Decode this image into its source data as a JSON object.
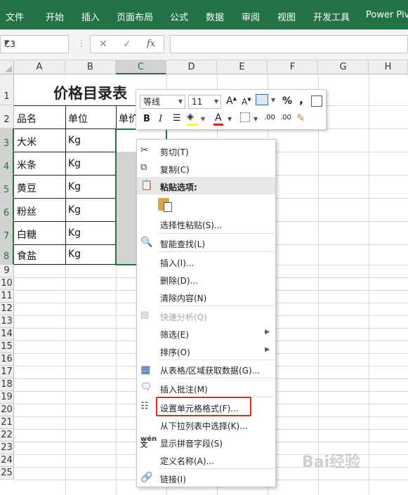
{
  "ribbon": {
    "tabs": [
      "文件",
      "开始",
      "插入",
      "页面布局",
      "公式",
      "数据",
      "审阅",
      "视图",
      "开发工具",
      "Power Pivo"
    ]
  },
  "formula_bar": {
    "name_box": "C3",
    "fx": "fx",
    "value": ""
  },
  "sheet": {
    "columns": [
      "A",
      "B",
      "C",
      "D",
      "E",
      "F",
      "G",
      "H"
    ],
    "rows": [
      "1",
      "2",
      "3",
      "4",
      "5",
      "6",
      "7",
      "8",
      "9",
      "10",
      "11",
      "12",
      "13",
      "14",
      "15",
      "16",
      "17",
      "18",
      "19",
      "20",
      "21",
      "22",
      "23",
      "24",
      "25"
    ],
    "title": "价格目录表",
    "headers": [
      "品名",
      "单位",
      "单价"
    ],
    "items": [
      {
        "name": "大米",
        "unit": "Kg"
      },
      {
        "name": "米条",
        "unit": "Kg"
      },
      {
        "name": "黄豆",
        "unit": "Kg"
      },
      {
        "name": "粉丝",
        "unit": "Kg"
      },
      {
        "name": "白糖",
        "unit": "Kg"
      },
      {
        "name": "食盐",
        "unit": "Kg"
      }
    ]
  },
  "mini_toolbar": {
    "font": "等线",
    "size": "11",
    "bold": "B",
    "italic": "I",
    "percent": "%",
    "comma": ","
  },
  "context_menu": {
    "cut": "剪切(T)",
    "copy": "复制(C)",
    "paste_options": "粘贴选项:",
    "paste_special": "选择性粘贴(S)...",
    "smart_lookup": "智能查找(L)",
    "insert": "插入(I)...",
    "delete": "删除(D)...",
    "clear": "清除内容(N)",
    "quick_analysis": "快速分析(Q)",
    "filter": "筛选(E)",
    "sort": "排序(O)",
    "from_table": "从表格/区域获取数据(G)...",
    "insert_comment": "插入批注(M)",
    "format_cells": "设置单元格格式(F)...",
    "pick_list": "从下拉列表中选择(K)...",
    "phonetic": "显示拼音字段(S)",
    "define_name": "定义名称(A)...",
    "link": "链接(I)"
  },
  "colors": {
    "ribbon": "#217346",
    "highlight": "#e8261f"
  }
}
